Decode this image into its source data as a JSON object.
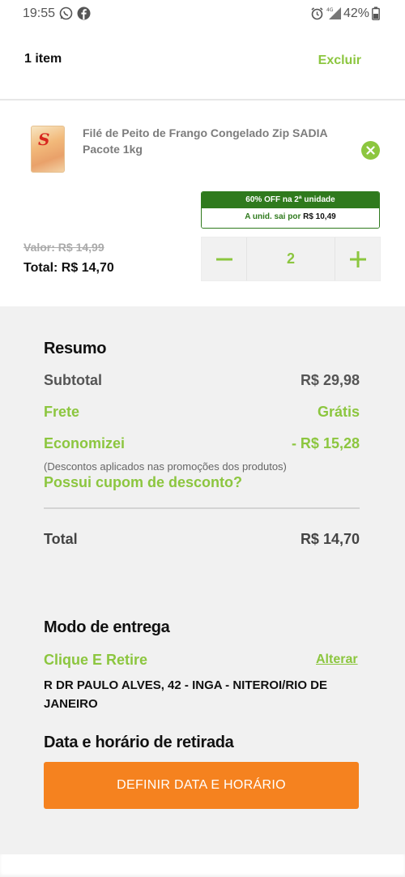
{
  "status_bar": {
    "time": "19:55",
    "icons": [
      "whatsapp-icon",
      "facebook-icon",
      "alarm-icon",
      "signal-icon",
      "battery-icon"
    ],
    "signal_label": "4G",
    "battery": "42%"
  },
  "header": {
    "item_count": "1 item",
    "delete_label": "Excluir"
  },
  "product": {
    "name": "Filé de Peito de Frango Congelado Zip SADIA Pacote 1kg",
    "promo_title": "60% OFF na 2ª unidade",
    "promo_unit_prefix": "A unid. sai por",
    "promo_unit_price": "R$ 10,49",
    "old_price": "Valor: R$ 14,99",
    "total": "Total: R$ 14,70",
    "quantity": "2"
  },
  "summary": {
    "title": "Resumo",
    "subtotal_label": "Subtotal",
    "subtotal_value": "R$ 29,98",
    "shipping_label": "Frete",
    "shipping_value": "Grátis",
    "savings_label": "Economizei",
    "savings_value": "- R$ 15,28",
    "savings_note": "(Descontos aplicados nas promoções dos produtos)",
    "coupon_link": "Possui cupom de desconto?",
    "total_label": "Total",
    "total_value": "R$ 14,70"
  },
  "delivery": {
    "title": "Modo de entrega",
    "mode": "Clique E Retire",
    "change_label": "Alterar",
    "address": "R DR PAULO ALVES, 42 - INGA - NITEROI/RIO DE JANEIRO"
  },
  "pickup": {
    "title": "Data e horário de retirada",
    "button_label": "DEFINIR DATA E HORÁRIO"
  },
  "colors": {
    "green": "#8cc63f",
    "dark_green": "#2f7a1d",
    "orange": "#f5821f",
    "background": "#f1f1f1"
  }
}
